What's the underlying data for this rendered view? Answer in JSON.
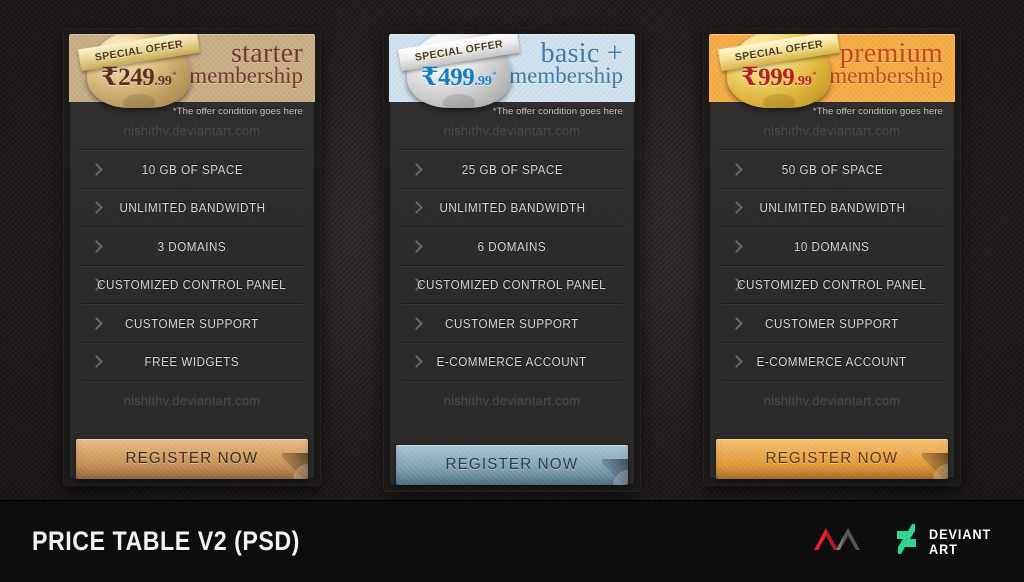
{
  "footer": {
    "title": "PRICE TABLE V2 (PSD)",
    "logos": [
      {
        "name": "nv-monogram-logo"
      },
      {
        "name": "deviantart-logo",
        "line1": "DEVIANT",
        "line2": "ART"
      }
    ]
  },
  "colors": {
    "page_bg": "#231f1e",
    "card_bg": "#2c2b29",
    "footer_bg": "#0e0d0d",
    "starter_header": "#c9ad84",
    "starter_title": "#72392a",
    "starter_button": "#cf9a5d",
    "basic_header": "#cfe2ee",
    "basic_title": "#3f7ba6",
    "basic_button": "#83a7b9",
    "premium_header": "#f6ac43",
    "premium_title": "#c1481f",
    "premium_button": "#e8a244",
    "deviantart_green": "#2fd691",
    "monogram_red": "#e8242a"
  },
  "plans": [
    {
      "id": "starter",
      "badge_label": "SPECIAL OFFER",
      "price_amount": "₹249",
      "price_cents": ".99",
      "price_star": "*",
      "title_line1": "starter",
      "title_line2": "membership",
      "note": "*The offer condition goes here",
      "watermark_top": "nishithv.deviantart.com",
      "watermark_bottom": "nishithv.deviantart.com",
      "features": [
        "10 GB OF SPACE",
        "UNLIMITED BANDWIDTH",
        "3 DOMAINS",
        "CUSTOMIZED CONTROL PANEL",
        "CUSTOMER SUPPORT",
        "FREE WIDGETS"
      ],
      "button_label": "REGISTER NOW"
    },
    {
      "id": "basic-plus",
      "badge_label": "SPECIAL OFFER",
      "price_amount": "₹499",
      "price_cents": ".99",
      "price_star": "*",
      "title_line1": "basic +",
      "title_line2": "membership",
      "note": "*The offer condition goes here",
      "watermark_top": "nishithv.deviantart.com",
      "watermark_bottom": "nishithv.deviantart.com",
      "features": [
        "25 GB OF SPACE",
        "UNLIMITED BANDWIDTH",
        "6 DOMAINS",
        "CUSTOMIZED CONTROL PANEL",
        "CUSTOMER SUPPORT",
        "E-COMMERCE ACCOUNT"
      ],
      "button_label": "REGISTER NOW"
    },
    {
      "id": "premium",
      "badge_label": "SPECIAL OFFER",
      "price_amount": "₹999",
      "price_cents": ".99",
      "price_star": "*",
      "title_line1": "premium",
      "title_line2": "membership",
      "note": "*The offer condition goes here",
      "watermark_top": "nishithv.deviantart.com",
      "watermark_bottom": "nishithv.deviantart.com",
      "features": [
        "50 GB OF SPACE",
        "UNLIMITED BANDWIDTH",
        "10 DOMAINS",
        "CUSTOMIZED CONTROL PANEL",
        "CUSTOMER SUPPORT",
        "E-COMMERCE ACCOUNT"
      ],
      "button_label": "REGISTER NOW"
    }
  ]
}
